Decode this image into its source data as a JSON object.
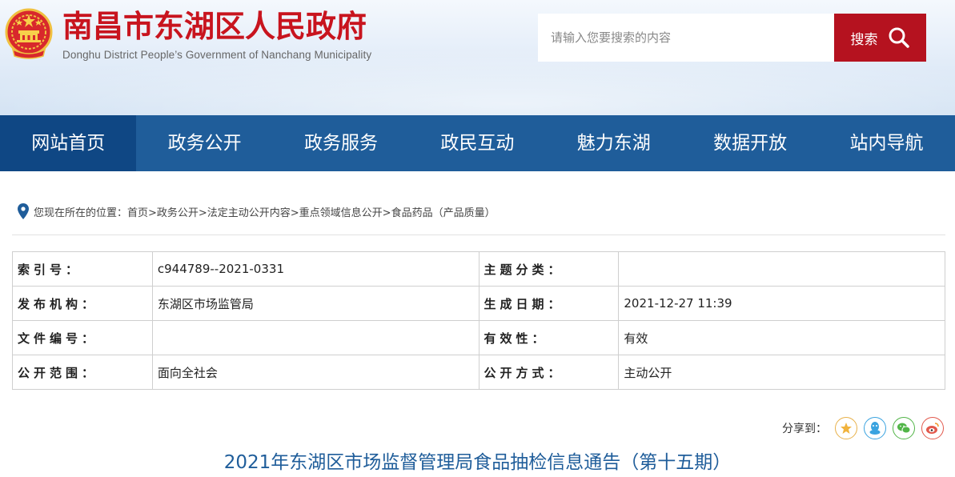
{
  "header": {
    "title": "南昌市东湖区人民政府",
    "subtitle": "Donghu District  People’s Government of Nanchang  Municipality",
    "search_placeholder": "请输入您要搜索的内容",
    "search_button_label": "搜索",
    "brand_color": "#c8141e"
  },
  "nav": {
    "items": [
      "网站首页",
      "政务公开",
      "政务服务",
      "政民互动",
      "魅力东湖",
      "数据开放",
      "站内导航"
    ],
    "active_index": 0,
    "color": "#1f5d9a",
    "active_color": "#0f4784"
  },
  "breadcrumb": {
    "text": "您现在所在的位置：首页>政务公开>法定主动公开内容>重点领域信息公开>食品药品（产品质量）"
  },
  "info": {
    "rows": [
      {
        "label1": "索引号：",
        "value1": "c944789--2021-0331",
        "label2": "主题分类：",
        "value2": ""
      },
      {
        "label1": "发布机构：",
        "value1": "东湖区市场监管局",
        "label2": "生成日期：",
        "value2": "2021-12-27 11:39"
      },
      {
        "label1": "文件编号：",
        "value1": "",
        "label2": "有效性：",
        "value2": "有效"
      },
      {
        "label1": "公开范围：",
        "value1": "面向全社会",
        "label2": "公开方式：",
        "value2": "主动公开"
      }
    ]
  },
  "share": {
    "label": "分享到：",
    "icons": [
      "star-icon",
      "qq-icon",
      "wechat-icon",
      "weibo-icon"
    ]
  },
  "article": {
    "title": "2021年东湖区市场监督管理局食品抽检信息通告（第十五期）"
  }
}
